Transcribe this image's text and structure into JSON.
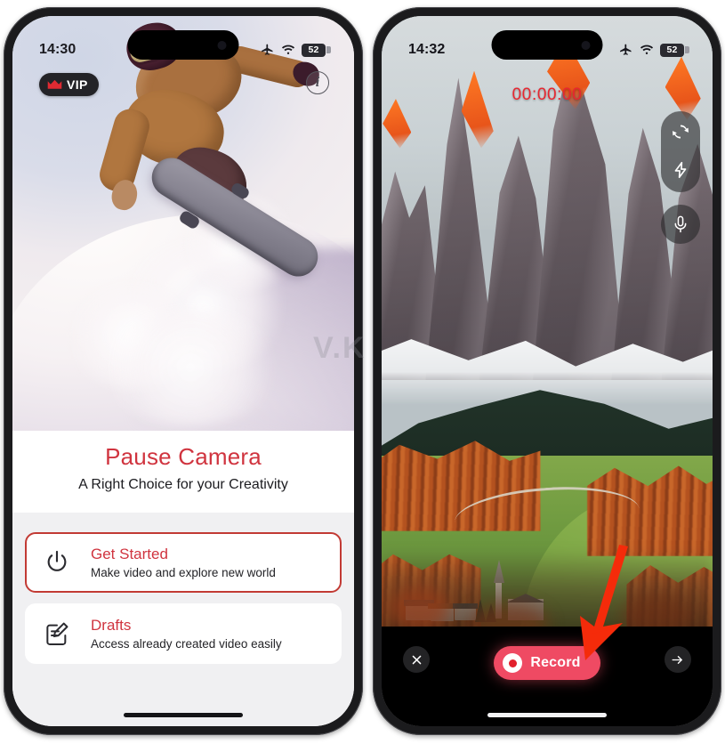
{
  "page": {
    "watermark": "V.K"
  },
  "left_phone": {
    "status_bar": {
      "time": "14:30",
      "airplane_icon": "airplane-mode-icon",
      "wifi_icon": "wifi-icon",
      "battery_level": "52"
    },
    "badge": {
      "label": "VIP",
      "icon": "crown-icon"
    },
    "info_button": {
      "label": "i",
      "icon": "info-icon"
    },
    "hero_image_alt": "snowboarder-carving-powder-snow",
    "title": "Pause Camera",
    "subtitle": "A Right Choice for your Creativity",
    "menu": [
      {
        "icon": "power-icon",
        "title": "Get Started",
        "subtitle": "Make video and explore new world",
        "selected": true
      },
      {
        "icon": "draft-edit-icon",
        "title": "Drafts",
        "subtitle": "Access already created video easily",
        "selected": false
      }
    ],
    "colors": {
      "accent": "#d0343f",
      "selected_border": "#c23a34",
      "list_bg": "#f0f0f2"
    }
  },
  "right_phone": {
    "status_bar": {
      "time": "14:32",
      "airplane_icon": "airplane-mode-icon",
      "wifi_icon": "wifi-icon",
      "battery_level": "52"
    },
    "recording_timer": "00:00:00",
    "viewfinder_alt": "dolomites-mountain-valley-village-autumn",
    "camera_controls": [
      {
        "icon": "camera-flip-icon",
        "name": "switch-camera"
      },
      {
        "icon": "flash-icon",
        "name": "flash-toggle"
      },
      {
        "icon": "microphone-icon",
        "name": "microphone-toggle"
      }
    ],
    "bottom_bar": {
      "close_icon": "close-icon",
      "record_label": "Record",
      "record_icon": "record-dot-icon",
      "next_icon": "arrow-right-icon"
    },
    "colors": {
      "timer": "#e8262f",
      "record_button": "#ef4a63",
      "record_dot": "#e2202c",
      "bar_bg": "#000000"
    },
    "annotation": {
      "type": "red-arrow",
      "points_to": "record-button",
      "color": "#f52b0a"
    }
  }
}
